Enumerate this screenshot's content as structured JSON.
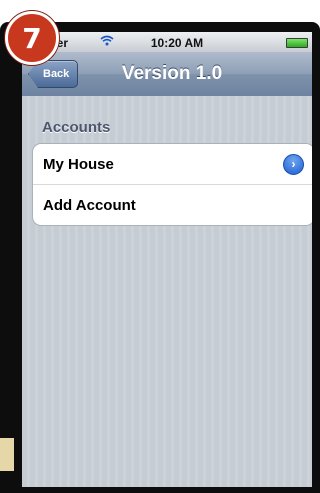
{
  "badge": {
    "number": "7"
  },
  "status_bar": {
    "carrier": "rrier",
    "time": "10:20 AM"
  },
  "nav_bar": {
    "back_label": "Back",
    "title": "Version 1.0"
  },
  "section": {
    "header": "Accounts"
  },
  "table": {
    "rows": [
      {
        "label": "My House",
        "accessory": "detail-disclosure-icon"
      },
      {
        "label": "Add Account"
      }
    ]
  },
  "colors": {
    "badge": "#c8381e",
    "nav_bar": "#6d83a1",
    "disclosure": "#1c5ed4",
    "background": "#c5ccd4"
  }
}
